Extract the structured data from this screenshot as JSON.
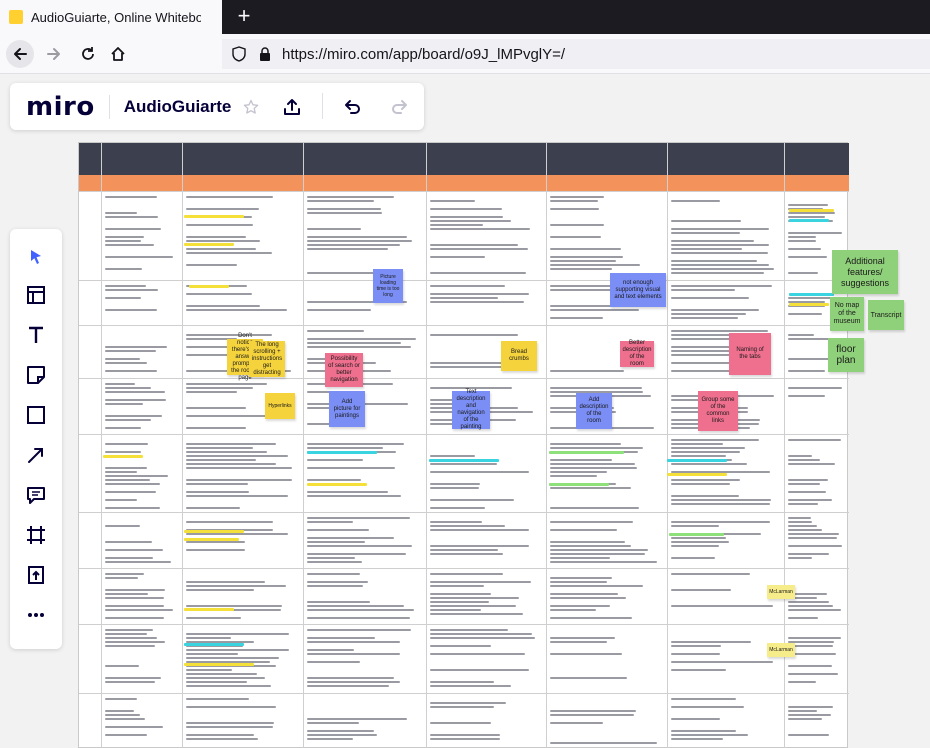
{
  "browser": {
    "tab_title": "AudioGuiarte, Online Whiteboar",
    "tab_close": "×",
    "new_tab": "+",
    "url": "https://miro.com/app/board/o9J_lMPvglY=/"
  },
  "miro": {
    "logo": "miro",
    "board_name": "AudioGuiarte"
  },
  "toolbar": {
    "tools": [
      "select-tool",
      "templates-tool",
      "text-tool",
      "sticky-note-tool",
      "shape-tool",
      "connection-line-tool",
      "comment-tool",
      "frame-tool",
      "upload-tool",
      "more-tools"
    ]
  },
  "board": {
    "stickies": [
      {
        "text": "Picture loading time is too long",
        "color": "#7b8ef5"
      },
      {
        "text": "not enough supporting visual and text elements",
        "color": "#7b8ef5"
      },
      {
        "text": "Don't notice there's an answer prompt in the room's page",
        "color": "#f5d33d"
      },
      {
        "text": "The long scrolling + instructions get distracting",
        "color": "#f5d33d"
      },
      {
        "text": "Bread crumbs",
        "color": "#f5d33d"
      },
      {
        "text": "Possibility of search or better navigation",
        "color": "#ee6f8e"
      },
      {
        "text": "Better description of the room",
        "color": "#ee6f8e"
      },
      {
        "text": "Naming of the tabs",
        "color": "#ee6f8e"
      },
      {
        "text": "Hyperlinks",
        "color": "#f5d33d"
      },
      {
        "text": "Add picture for paintings",
        "color": "#7b8ef5"
      },
      {
        "text": "Text description and navigation of the painting",
        "color": "#7b8ef5"
      },
      {
        "text": "Add description of the room",
        "color": "#7b8ef5"
      },
      {
        "text": "Group some of the common links",
        "color": "#ee6f8e"
      },
      {
        "text": "McLarman",
        "color": "#f7ec8a"
      },
      {
        "text": "McLarman",
        "color": "#f7ec8a"
      }
    ]
  },
  "side_stickies": [
    {
      "text": "Additional features/ suggestions"
    },
    {
      "text": "No map of the museum"
    },
    {
      "text": "Transcript"
    },
    {
      "text": "floor plan"
    }
  ]
}
